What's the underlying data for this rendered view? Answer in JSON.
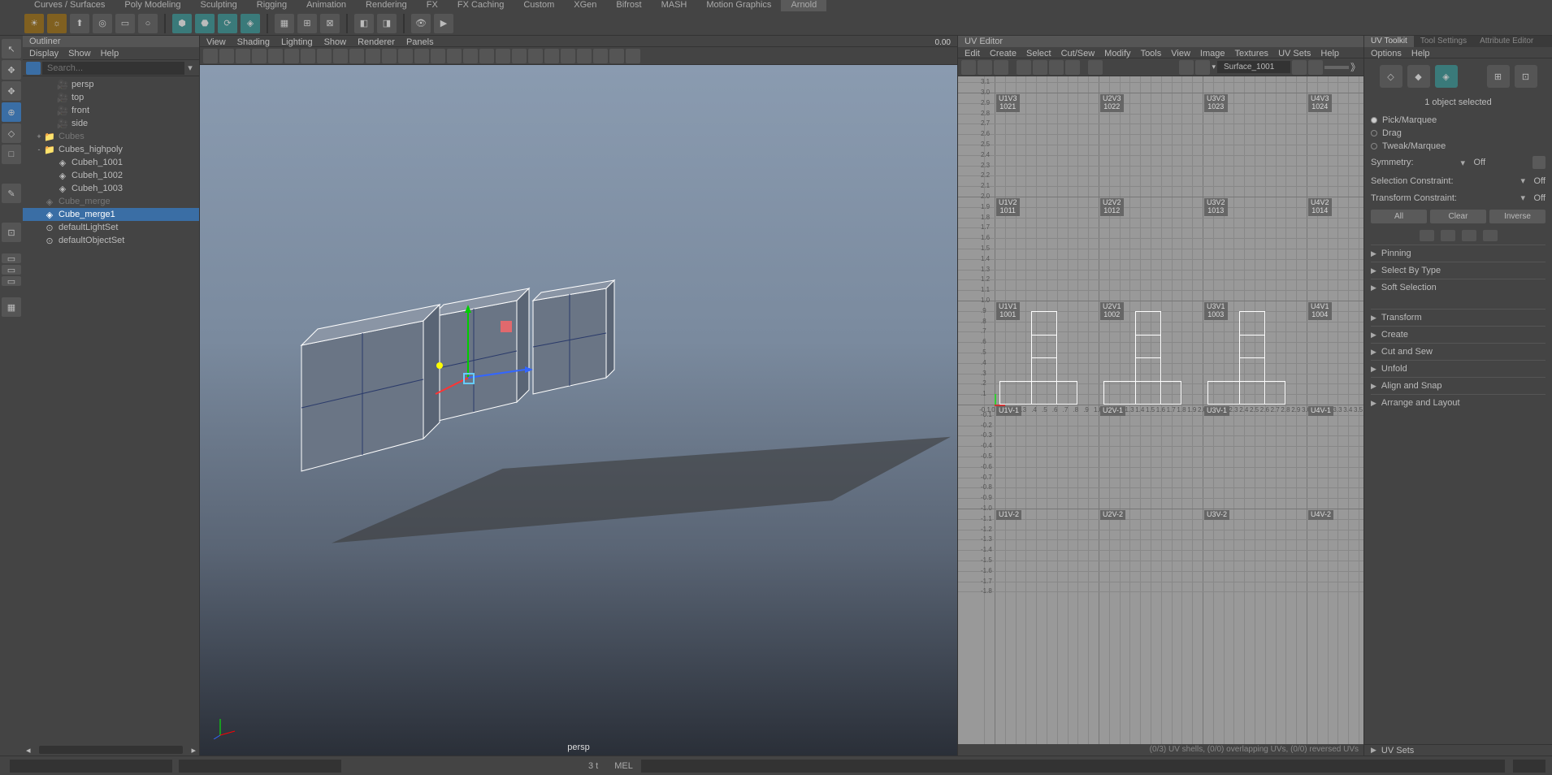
{
  "top_menu": [
    "Curves / Surfaces",
    "Poly Modeling",
    "Sculpting",
    "Rigging",
    "Animation",
    "Rendering",
    "FX",
    "FX Caching",
    "Custom",
    "XGen",
    "Bifrost",
    "MASH",
    "Motion Graphics",
    "Arnold"
  ],
  "active_top_menu": "Arnold",
  "outliner": {
    "title": "Outliner",
    "menu": [
      "Display",
      "Show",
      "Help"
    ],
    "search_placeholder": "Search...",
    "items": [
      {
        "name": "persp",
        "type": "camera",
        "indent": 1
      },
      {
        "name": "top",
        "type": "camera",
        "indent": 1
      },
      {
        "name": "front",
        "type": "camera",
        "indent": 1
      },
      {
        "name": "side",
        "type": "camera",
        "indent": 1
      },
      {
        "name": "Cubes",
        "type": "group",
        "indent": 0,
        "expand": "+",
        "dimmed": true
      },
      {
        "name": "Cubes_highpoly",
        "type": "group",
        "indent": 0,
        "expand": "-"
      },
      {
        "name": "Cubeh_1001",
        "type": "mesh",
        "indent": 1
      },
      {
        "name": "Cubeh_1002",
        "type": "mesh",
        "indent": 1
      },
      {
        "name": "Cubeh_1003",
        "type": "mesh",
        "indent": 1
      },
      {
        "name": "Cube_merge",
        "type": "mesh",
        "indent": 0,
        "dimmed": true
      },
      {
        "name": "Cube_merge1",
        "type": "mesh",
        "indent": 0,
        "selected": true
      },
      {
        "name": "defaultLightSet",
        "type": "set",
        "indent": 0
      },
      {
        "name": "defaultObjectSet",
        "type": "set",
        "indent": 0
      }
    ]
  },
  "viewport": {
    "menu": [
      "View",
      "Shading",
      "Lighting",
      "Show",
      "Renderer",
      "Panels"
    ],
    "label": "persp",
    "coord": "0.00"
  },
  "uv_editor": {
    "title": "UV Editor",
    "menu": [
      "Edit",
      "Create",
      "Select",
      "Cut/Sew",
      "Modify",
      "Tools",
      "View",
      "Image",
      "Textures",
      "UV Sets",
      "Help"
    ],
    "surface": "Surface_1001",
    "status": "(0/3) UV shells, (0/0) overlapping UVs, (0/0) reversed UVs",
    "udim_labels": [
      {
        "t": "U1V3",
        "n": "1021"
      },
      {
        "t": "U2V3",
        "n": "1022"
      },
      {
        "t": "U3V3",
        "n": "1023"
      },
      {
        "t": "U4V3",
        "n": "1024"
      },
      {
        "t": "U1V2",
        "n": "1011"
      },
      {
        "t": "U2V2",
        "n": "1012"
      },
      {
        "t": "U3V2",
        "n": "1013"
      },
      {
        "t": "U4V2",
        "n": "1014"
      },
      {
        "t": "U1V1",
        "n": "1001"
      },
      {
        "t": "U2V1",
        "n": "1002"
      },
      {
        "t": "U3V1",
        "n": "1003"
      },
      {
        "t": "U4V1",
        "n": "1004"
      },
      {
        "t": "U1V-1",
        "n": ""
      },
      {
        "t": "U2V-1",
        "n": ""
      },
      {
        "t": "U3V-1",
        "n": ""
      },
      {
        "t": "U4V-1",
        "n": ""
      },
      {
        "t": "U1V-2",
        "n": ""
      },
      {
        "t": "U2V-2",
        "n": ""
      },
      {
        "t": "U3V-2",
        "n": ""
      },
      {
        "t": "U4V-2",
        "n": ""
      }
    ]
  },
  "uv_toolkit": {
    "tabs": [
      "UV Toolkit",
      "Tool Settings",
      "Attribute Editor"
    ],
    "active_tab": "UV Toolkit",
    "menu": [
      "Options",
      "Help"
    ],
    "selection_info": "1 object selected",
    "modes": [
      {
        "label": "Pick/Marquee",
        "checked": true
      },
      {
        "label": "Drag",
        "checked": false
      },
      {
        "label": "Tweak/Marquee",
        "checked": false
      }
    ],
    "symmetry_label": "Symmetry:",
    "symmetry_value": "Off",
    "sel_constraint_label": "Selection Constraint:",
    "sel_constraint_value": "Off",
    "trans_constraint_label": "Transform Constraint:",
    "trans_constraint_value": "Off",
    "buttons": {
      "all": "All",
      "clear": "Clear",
      "inverse": "Inverse"
    },
    "sections1": [
      "Pinning",
      "Select By Type",
      "Soft Selection"
    ],
    "sections2": [
      "Transform",
      "Create",
      "Cut and Sew",
      "Unfold",
      "Align and Snap",
      "Arrange and Layout"
    ],
    "uv_sets_label": "UV Sets"
  },
  "status_bar": {
    "time_label": "3 t",
    "mel_label": "MEL"
  }
}
